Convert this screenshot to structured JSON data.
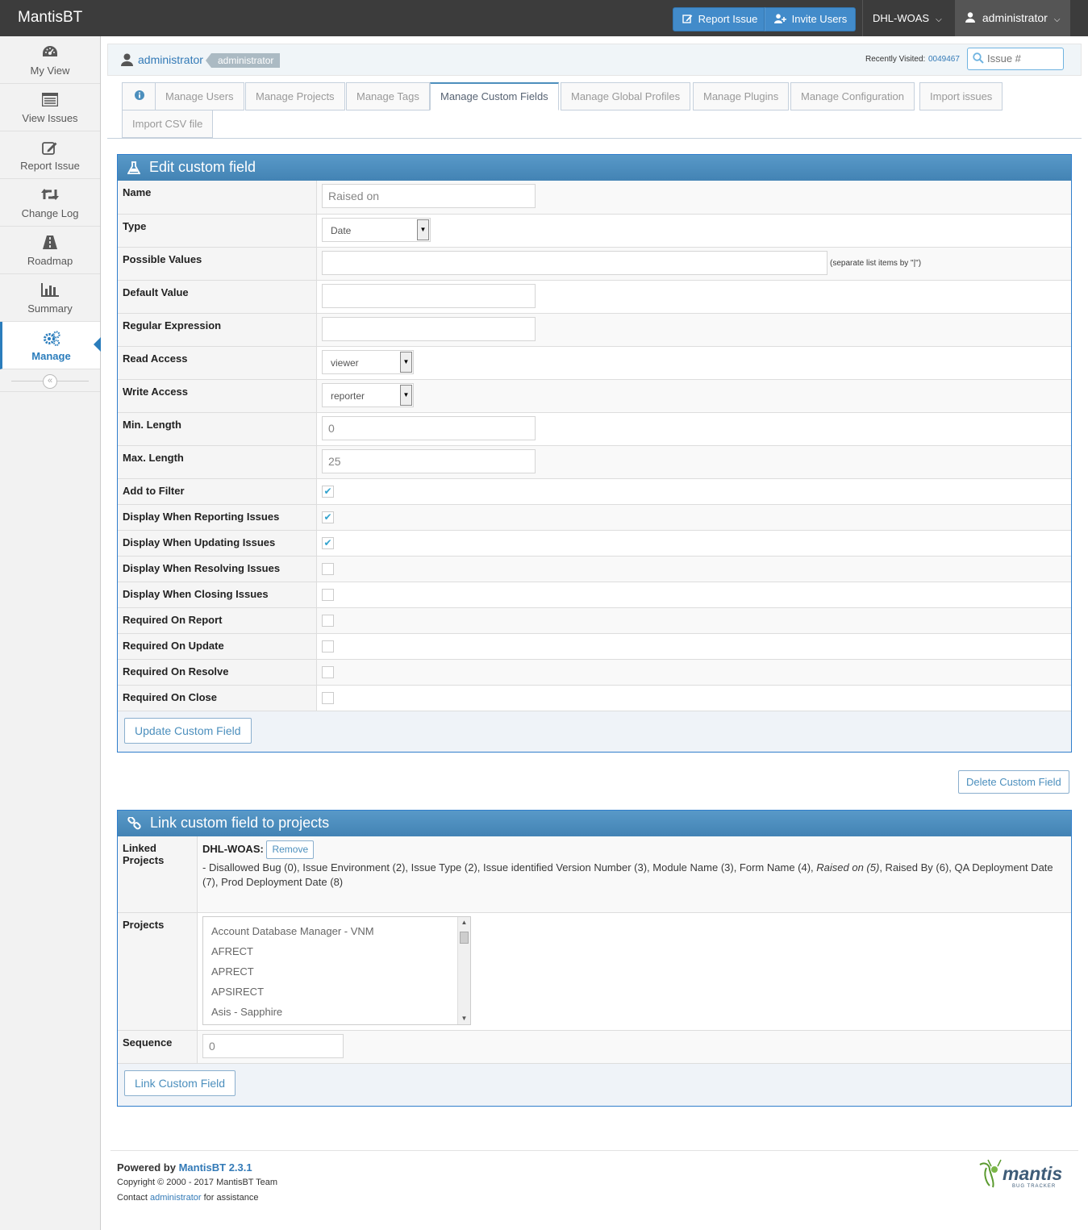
{
  "app": {
    "brand": "MantisBT"
  },
  "navbar": {
    "report_issue": "Report Issue",
    "invite_users": "Invite Users",
    "project": "DHL-WOAS",
    "user": "administrator"
  },
  "sidebar": {
    "items": [
      {
        "label": "My View",
        "icon": "dashboard-icon"
      },
      {
        "label": "View Issues",
        "icon": "list-icon"
      },
      {
        "label": "Report Issue",
        "icon": "edit-icon"
      },
      {
        "label": "Change Log",
        "icon": "retweet-icon"
      },
      {
        "label": "Roadmap",
        "icon": "road-icon"
      },
      {
        "label": "Summary",
        "icon": "bar-chart-icon"
      },
      {
        "label": "Manage",
        "icon": "gears-icon"
      }
    ],
    "active": "Manage"
  },
  "breadcrumb": {
    "user": "administrator",
    "role": "administrator",
    "recent_label": "Recently Visited:",
    "recent_issue": "0049467",
    "search_placeholder": "Issue #"
  },
  "tabs": [
    {
      "label": ""
    },
    {
      "label": "Manage Users"
    },
    {
      "label": "Manage Projects"
    },
    {
      "label": "Manage Tags"
    },
    {
      "label": "Manage Custom Fields"
    },
    {
      "label": "Manage Global Profiles"
    },
    {
      "label": "Manage Plugins"
    },
    {
      "label": "Manage Configuration"
    },
    {
      "label": "Import issues"
    },
    {
      "label": "Import CSV file"
    }
  ],
  "edit": {
    "title": "Edit custom field",
    "labels": {
      "name": "Name",
      "type": "Type",
      "possible": "Possible Values",
      "default": "Default Value",
      "regex": "Regular Expression",
      "read": "Read Access",
      "write": "Write Access",
      "min": "Min. Length",
      "max": "Max. Length",
      "filter": "Add to Filter",
      "disp_report": "Display When Reporting Issues",
      "disp_update": "Display When Updating Issues",
      "disp_resolve": "Display When Resolving Issues",
      "disp_close": "Display When Closing Issues",
      "req_report": "Required On Report",
      "req_update": "Required On Update",
      "req_resolve": "Required On Resolve",
      "req_close": "Required On Close"
    },
    "values": {
      "name": "Raised on",
      "type": "Date",
      "possible": "",
      "possible_hint": "(separate list items by \"|\")",
      "default": "",
      "regex": "",
      "read": "viewer",
      "write": "reporter",
      "min": "0",
      "max": "25"
    },
    "checks": {
      "filter": true,
      "disp_report": true,
      "disp_update": true,
      "disp_resolve": false,
      "disp_close": false,
      "req_report": false,
      "req_update": false,
      "req_resolve": false,
      "req_close": false
    },
    "update_button": "Update Custom Field",
    "delete_button": "Delete Custom Field"
  },
  "link": {
    "title": "Link custom field to projects",
    "linked_label": "Linked Projects",
    "linked_project": "DHL-WOAS:",
    "remove_button": "Remove",
    "fields_before": "- Disallowed Bug (0), Issue Environment (2), Issue Type (2), Issue identified Version Number (3), Module Name (3), Form Name (4), ",
    "fields_current": "Raised on (5)",
    "fields_after": ", Raised By (6), QA Deployment Date (7), Prod Deployment Date (8)",
    "projects_label": "Projects",
    "projects": [
      "Account Database Manager - VNM",
      "AFRECT",
      "APRECT",
      "APSIRECT",
      "Asis - Sapphire"
    ],
    "sequence_label": "Sequence",
    "sequence": "0",
    "link_button": "Link Custom Field"
  },
  "footer": {
    "powered_by": "Powered by ",
    "powered_link": "MantisBT 2.3.1",
    "copyright": "Copyright © 2000 - 2017 MantisBT Team",
    "contact_pre": "Contact ",
    "contact_link": "administrator",
    "contact_post": " for assistance",
    "logo_text": "mantis",
    "logo_sub": "BUG TRACKER"
  }
}
